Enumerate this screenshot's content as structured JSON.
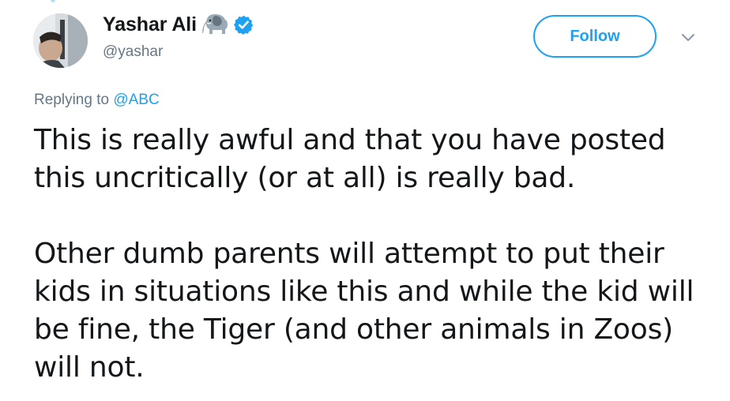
{
  "tweet": {
    "author": {
      "display_name": "Yashar Ali",
      "handle": "@yashar",
      "name_emoji_icon": "elephant-icon",
      "verified_icon": "verified-badge-icon",
      "avatar_icon": "profile-avatar"
    },
    "follow_label": "Follow",
    "more_icon": "chevron-down-icon",
    "reply": {
      "prefix": "Replying to",
      "target": "@ABC"
    },
    "body": {
      "paragraph_1": "This is really awful and that you have posted this uncritically (or at all) is really bad.",
      "paragraph_2": "Other dumb parents will attempt to put their kids in situations like this and while the kid will be fine, the Tiger (and other animals in Zoos) will not."
    }
  },
  "colors": {
    "accent": "#1da1f2",
    "secondary_text": "#657786",
    "primary_text": "#14171a"
  }
}
